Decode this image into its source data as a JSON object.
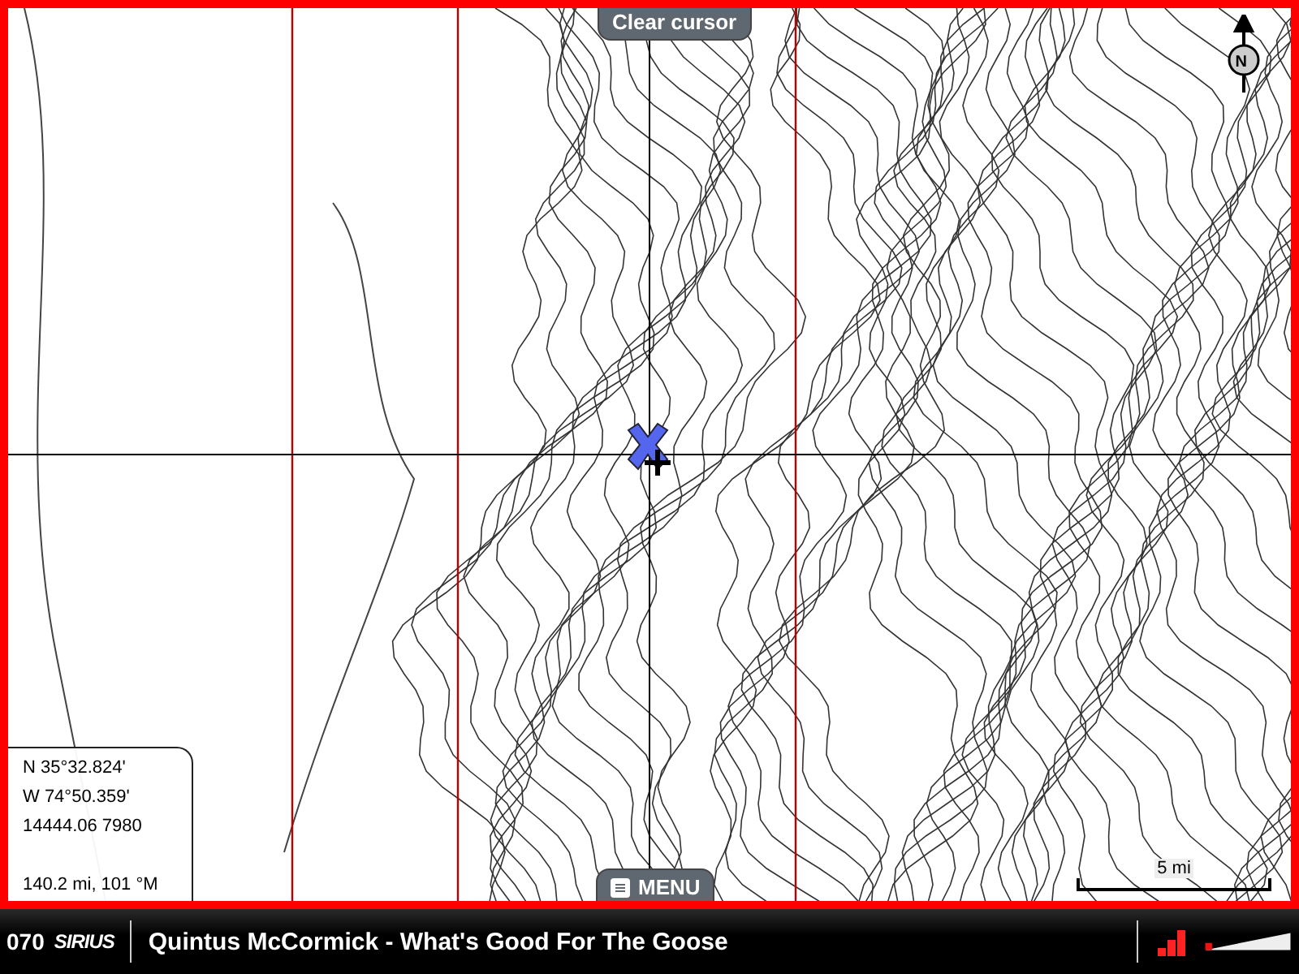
{
  "map": {
    "clear_cursor": "Clear cursor",
    "north_label": "N",
    "menu": "MENU",
    "scale": "5 mi",
    "cursor_info": {
      "latitude": "N 35°32.824'",
      "longitude": "W 74°50.359'",
      "loran": "14444.06 7980",
      "range_bearing": "140.2 mi, 101 °M"
    }
  },
  "status_bar": {
    "channel": "070",
    "logo": "SIRIUS",
    "now_playing": "Quintus McCormick - What's Good For The Goose",
    "volume": {
      "level": 0.08
    }
  }
}
